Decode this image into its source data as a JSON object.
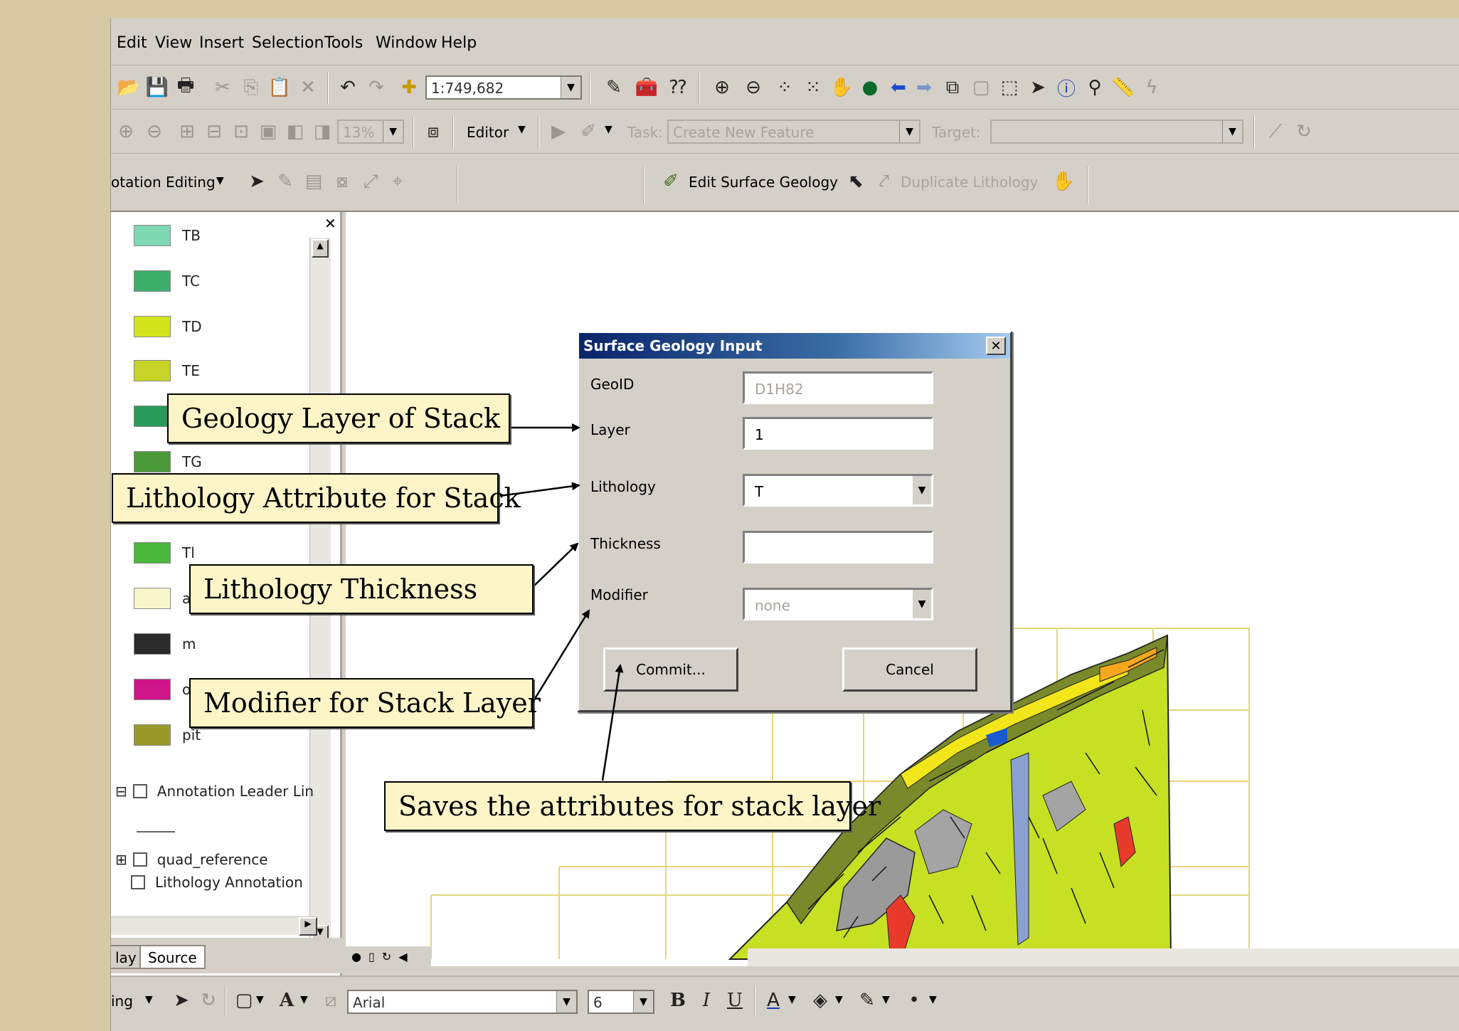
{
  "menu": {
    "items": [
      "Edit",
      "View",
      "Insert",
      "Selection",
      "Tools",
      "Window",
      "Help"
    ]
  },
  "toolbar1": {
    "scale_value": "1:749,682"
  },
  "toolbar2": {
    "zoom_value": "13%",
    "editor_label": "Editor",
    "task_label": "Task:",
    "task_value": "Create New Feature",
    "target_label": "Target:"
  },
  "toolbar3": {
    "annotation_label": "otation Editing",
    "edit_surface_label": "Edit Surface Geology",
    "duplicate_label": "Duplicate Lithology"
  },
  "toc": {
    "legend": [
      {
        "label": "TB",
        "color": "#7fd8b4"
      },
      {
        "label": "TC",
        "color": "#3cae6a"
      },
      {
        "label": "TD",
        "color": "#d4e41c"
      },
      {
        "label": "TE",
        "color": "#c6d428"
      },
      {
        "label": "",
        "color": "#2a9a5a"
      },
      {
        "label": "TG",
        "color": "#4a9a3a"
      },
      {
        "label": "",
        "color": "#60c040"
      },
      {
        "label": "Tl",
        "color": "#4ab83a"
      },
      {
        "label": "a",
        "color": "#faf6cc"
      },
      {
        "label": "m",
        "color": "#2a2a2a"
      },
      {
        "label": "o",
        "color": "#d0148a"
      },
      {
        "label": "pit",
        "color": "#9a9a2a"
      }
    ],
    "layers": [
      {
        "label": "Annotation Leader Lin"
      },
      {
        "label": "quad_reference"
      },
      {
        "label": "Lithology Annotation"
      }
    ],
    "tabs": [
      "lay",
      "Source"
    ]
  },
  "drawing": {
    "label": "ing",
    "font_value": "Arial",
    "size_value": "6"
  },
  "dialog": {
    "title": "Surface Geology Input",
    "geoid_label": "GeoID",
    "geoid_value": "D1H82",
    "layer_label": "Layer",
    "layer_value": "1",
    "lithology_label": "Lithology",
    "lithology_value": "T",
    "thickness_label": "Thickness",
    "thickness_value": "",
    "modifier_label": "Modifier",
    "modifier_value": "none",
    "commit_label": "Commit...",
    "cancel_label": "Cancel"
  },
  "callouts": {
    "geology_layer": "Geology Layer of Stack",
    "lithology_attr": "Lithology Attribute for Stack",
    "thickness": "Lithology Thickness",
    "modifier": "Modifier for Stack Layer",
    "saves": "Saves the attributes for stack layer"
  }
}
